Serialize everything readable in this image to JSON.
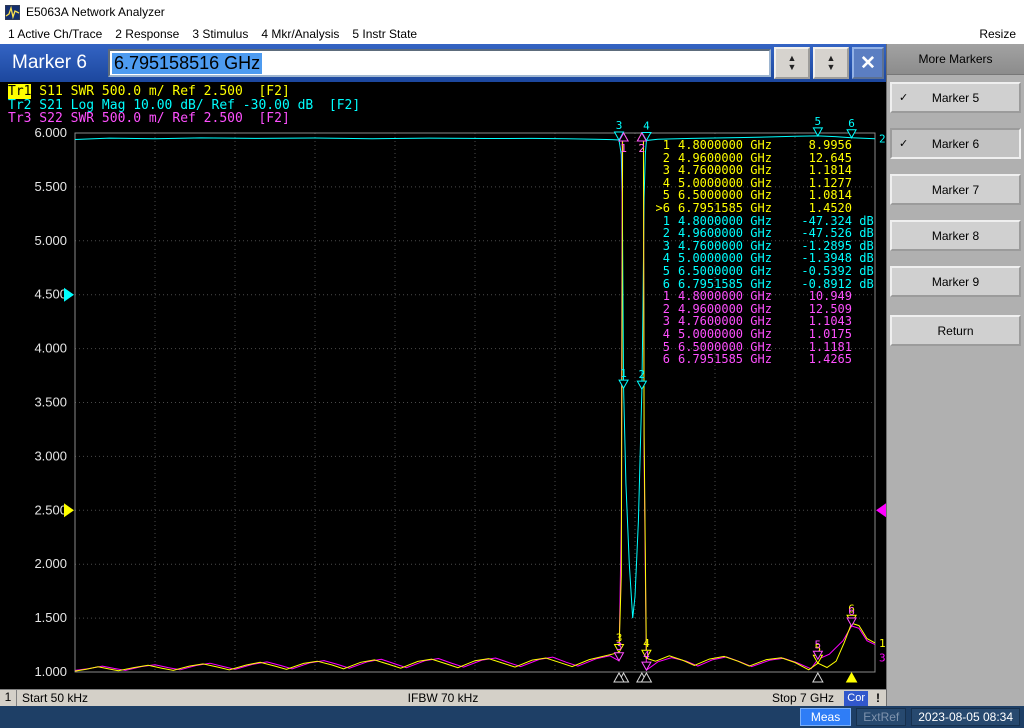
{
  "title_bar": {
    "title": "E5063A Network Analyzer"
  },
  "menu_bar": {
    "items": [
      "1 Active Ch/Trace",
      "2 Response",
      "3 Stimulus",
      "4 Mkr/Analysis",
      "5 Instr State"
    ],
    "resize": "Resize"
  },
  "marker_entry": {
    "label": "Marker 6",
    "value": "6.795158516 GHz"
  },
  "softkeys": {
    "header": "More Markers",
    "buttons": [
      {
        "label": "Marker 5",
        "checked": true,
        "active": false
      },
      {
        "label": "Marker 6",
        "checked": true,
        "active": true
      },
      {
        "label": "Marker 7",
        "checked": false,
        "active": false
      },
      {
        "label": "Marker 8",
        "checked": false,
        "active": false
      },
      {
        "label": "Marker 9",
        "checked": false,
        "active": false
      }
    ],
    "return_label": "Return"
  },
  "traces": [
    {
      "id": "Tr1",
      "label": "S11 SWR 500.0 m/ Ref 2.500",
      "status": "[F2]",
      "color": "#ffff00",
      "active": true
    },
    {
      "id": "Tr2",
      "label": "S21 Log Mag 10.00 dB/ Ref -30.00 dB",
      "status": "[F2]",
      "color": "#00ffff",
      "active": false
    },
    {
      "id": "Tr3",
      "label": "S22 SWR 500.0 m/ Ref 2.500",
      "status": "[F2]",
      "color": "#ff50ff",
      "active": false
    }
  ],
  "marker_table": {
    "tr1": {
      "color": "#ffff00",
      "unit": "",
      "rows": [
        {
          "n": "1",
          "f": "4.8000000 GHz",
          "v": "8.9956",
          "active": false
        },
        {
          "n": "2",
          "f": "4.9600000 GHz",
          "v": "12.645",
          "active": false
        },
        {
          "n": "3",
          "f": "4.7600000 GHz",
          "v": "1.1814",
          "active": false
        },
        {
          "n": "4",
          "f": "5.0000000 GHz",
          "v": "1.1277",
          "active": false
        },
        {
          "n": "5",
          "f": "6.5000000 GHz",
          "v": "1.0814",
          "active": false
        },
        {
          "n": "6",
          "f": "6.7951585 GHz",
          "v": "1.4520",
          "active": true
        }
      ]
    },
    "tr2": {
      "color": "#00ffff",
      "unit": " dB",
      "rows": [
        {
          "n": "1",
          "f": "4.8000000 GHz",
          "v": "-47.324",
          "active": false
        },
        {
          "n": "2",
          "f": "4.9600000 GHz",
          "v": "-47.526",
          "active": false
        },
        {
          "n": "3",
          "f": "4.7600000 GHz",
          "v": "-1.2895",
          "active": false
        },
        {
          "n": "4",
          "f": "5.0000000 GHz",
          "v": "-1.3948",
          "active": false
        },
        {
          "n": "5",
          "f": "6.5000000 GHz",
          "v": "-0.5392",
          "active": false
        },
        {
          "n": "6",
          "f": "6.7951585 GHz",
          "v": "-0.8912",
          "active": false
        }
      ]
    },
    "tr3": {
      "color": "#ff50ff",
      "unit": "",
      "rows": [
        {
          "n": "1",
          "f": "4.8000000 GHz",
          "v": "10.949",
          "active": false
        },
        {
          "n": "2",
          "f": "4.9600000 GHz",
          "v": "12.509",
          "active": false
        },
        {
          "n": "3",
          "f": "4.7600000 GHz",
          "v": "1.1043",
          "active": false
        },
        {
          "n": "4",
          "f": "5.0000000 GHz",
          "v": "1.0175",
          "active": false
        },
        {
          "n": "5",
          "f": "6.5000000 GHz",
          "v": "1.1181",
          "active": false
        },
        {
          "n": "6",
          "f": "6.7951585 GHz",
          "v": "1.4265",
          "active": false
        }
      ]
    }
  },
  "channel_status": {
    "channel": "1",
    "start": "Start 50 kHz",
    "ifbw": "IFBW 70 kHz",
    "stop": "Stop 7 GHz",
    "cor": "Cor",
    "warn": "!"
  },
  "status_bar": {
    "meas": "Meas",
    "extref": "ExtRef",
    "datetime": "2023-08-05 08:34"
  },
  "chart_data": {
    "type": "line",
    "title": "",
    "x_axis": {
      "label_start": "Start 50 kHz",
      "label_stop": "Stop 7 GHz",
      "min_ghz": 5e-05,
      "max_ghz": 7
    },
    "y_axis": {
      "ticks": [
        "6.000",
        "5.500",
        "5.000",
        "4.500",
        "4.000",
        "3.500",
        "3.000",
        "2.500",
        "2.000",
        "1.500",
        "1.000"
      ],
      "swr_min": 1.0,
      "swr_max": 6.0,
      "swr_per_div": 0.5,
      "tr2_ref_db": -30,
      "tr2_db_per_div": 10,
      "divisions": 10,
      "grid": true
    },
    "series": [
      {
        "name": "Tr1 S11 SWR",
        "color": "#ffff00",
        "unit": "SWR",
        "points": [
          [
            5e-05,
            1.008
          ],
          [
            0.1,
            1.025
          ],
          [
            0.2,
            1.048
          ],
          [
            0.3,
            1.028
          ],
          [
            0.38,
            1.012
          ],
          [
            0.52,
            1.042
          ],
          [
            0.64,
            1.062
          ],
          [
            0.76,
            1.035
          ],
          [
            0.86,
            1.015
          ],
          [
            1.0,
            1.055
          ],
          [
            1.12,
            1.075
          ],
          [
            1.25,
            1.045
          ],
          [
            1.35,
            1.02
          ],
          [
            1.5,
            1.065
          ],
          [
            1.62,
            1.09
          ],
          [
            1.75,
            1.055
          ],
          [
            1.85,
            1.025
          ],
          [
            2.0,
            1.08
          ],
          [
            2.12,
            1.1
          ],
          [
            2.25,
            1.065
          ],
          [
            2.35,
            1.03
          ],
          [
            2.5,
            1.09
          ],
          [
            2.62,
            1.112
          ],
          [
            2.75,
            1.07
          ],
          [
            2.85,
            1.035
          ],
          [
            3.0,
            1.098
          ],
          [
            3.12,
            1.12
          ],
          [
            3.25,
            1.075
          ],
          [
            3.35,
            1.04
          ],
          [
            3.5,
            1.105
          ],
          [
            3.62,
            1.124
          ],
          [
            3.75,
            1.08
          ],
          [
            3.85,
            1.045
          ],
          [
            4.0,
            1.11
          ],
          [
            4.12,
            1.13
          ],
          [
            4.25,
            1.085
          ],
          [
            4.35,
            1.05
          ],
          [
            4.5,
            1.115
          ],
          [
            4.62,
            1.145
          ],
          [
            4.7,
            1.165
          ],
          [
            4.76,
            1.1814
          ],
          [
            4.78,
            1.9
          ],
          [
            4.8,
            8.9956
          ],
          [
            4.84,
            25
          ],
          [
            4.88,
            34
          ],
          [
            4.93,
            26
          ],
          [
            4.96,
            12.645
          ],
          [
            4.98,
            3.2
          ],
          [
            5.0,
            1.1277
          ],
          [
            5.08,
            1.1
          ],
          [
            5.2,
            1.15
          ],
          [
            5.32,
            1.108
          ],
          [
            5.42,
            1.06
          ],
          [
            5.55,
            1.12
          ],
          [
            5.68,
            1.145
          ],
          [
            5.8,
            1.1
          ],
          [
            5.9,
            1.055
          ],
          [
            6.05,
            1.115
          ],
          [
            6.18,
            1.132
          ],
          [
            6.3,
            1.088
          ],
          [
            6.42,
            1.02
          ],
          [
            6.5,
            1.0814
          ],
          [
            6.58,
            1.042
          ],
          [
            6.66,
            1.1
          ],
          [
            6.73,
            1.27
          ],
          [
            6.7952,
            1.452
          ],
          [
            6.86,
            1.43
          ],
          [
            6.93,
            1.31
          ],
          [
            7.0,
            1.27
          ]
        ]
      },
      {
        "name": "Tr2 S21 Log Mag",
        "color": "#00ffff",
        "unit": "dB",
        "points": [
          [
            5e-05,
            -1.2
          ],
          [
            0.3,
            -0.95
          ],
          [
            0.7,
            -1.05
          ],
          [
            1.1,
            -0.9
          ],
          [
            1.6,
            -1.0
          ],
          [
            2.1,
            -0.92
          ],
          [
            2.6,
            -1.05
          ],
          [
            3.1,
            -0.95
          ],
          [
            3.6,
            -1.02
          ],
          [
            4.0,
            -1.0
          ],
          [
            4.3,
            -1.08
          ],
          [
            4.55,
            -1.15
          ],
          [
            4.7,
            -1.22
          ],
          [
            4.76,
            -1.2895
          ],
          [
            4.78,
            -4
          ],
          [
            4.79,
            -15
          ],
          [
            4.8,
            -47.324
          ],
          [
            4.82,
            -65
          ],
          [
            4.85,
            -80
          ],
          [
            4.88,
            -90
          ],
          [
            4.9,
            -86
          ],
          [
            4.93,
            -72
          ],
          [
            4.95,
            -56
          ],
          [
            4.96,
            -47.526
          ],
          [
            4.97,
            -32
          ],
          [
            4.98,
            -12
          ],
          [
            4.99,
            -4
          ],
          [
            5.0,
            -1.3948
          ],
          [
            5.1,
            -1.15
          ],
          [
            5.4,
            -1.0
          ],
          [
            5.8,
            -0.85
          ],
          [
            6.1,
            -0.72
          ],
          [
            6.3,
            -0.62
          ],
          [
            6.5,
            -0.5392
          ],
          [
            6.65,
            -0.66
          ],
          [
            6.7952,
            -0.8912
          ],
          [
            6.9,
            -0.98
          ],
          [
            7.0,
            -1.05
          ]
        ]
      },
      {
        "name": "Tr3 S22 SWR",
        "color": "#ff00ff",
        "unit": "SWR",
        "points": [
          [
            5e-05,
            1.015
          ],
          [
            0.12,
            1.032
          ],
          [
            0.24,
            1.055
          ],
          [
            0.34,
            1.033
          ],
          [
            0.44,
            1.015
          ],
          [
            0.58,
            1.05
          ],
          [
            0.7,
            1.068
          ],
          [
            0.82,
            1.04
          ],
          [
            0.92,
            1.02
          ],
          [
            1.06,
            1.06
          ],
          [
            1.18,
            1.082
          ],
          [
            1.3,
            1.05
          ],
          [
            1.4,
            1.025
          ],
          [
            1.56,
            1.072
          ],
          [
            1.68,
            1.094
          ],
          [
            1.8,
            1.06
          ],
          [
            1.9,
            1.03
          ],
          [
            2.06,
            1.086
          ],
          [
            2.18,
            1.106
          ],
          [
            2.3,
            1.07
          ],
          [
            2.4,
            1.035
          ],
          [
            2.56,
            1.096
          ],
          [
            2.68,
            1.118
          ],
          [
            2.8,
            1.075
          ],
          [
            2.9,
            1.04
          ],
          [
            3.06,
            1.104
          ],
          [
            3.18,
            1.125
          ],
          [
            3.3,
            1.08
          ],
          [
            3.4,
            1.045
          ],
          [
            3.56,
            1.11
          ],
          [
            3.68,
            1.13
          ],
          [
            3.8,
            1.085
          ],
          [
            3.9,
            1.05
          ],
          [
            4.06,
            1.116
          ],
          [
            4.18,
            1.138
          ],
          [
            4.3,
            1.09
          ],
          [
            4.4,
            1.055
          ],
          [
            4.56,
            1.122
          ],
          [
            4.68,
            1.15
          ],
          [
            4.76,
            1.1043
          ],
          [
            4.78,
            2.4
          ],
          [
            4.8,
            10.949
          ],
          [
            4.84,
            26
          ],
          [
            4.88,
            35
          ],
          [
            4.93,
            27
          ],
          [
            4.96,
            12.509
          ],
          [
            4.98,
            3.0
          ],
          [
            5.0,
            1.0175
          ],
          [
            5.1,
            1.095
          ],
          [
            5.22,
            1.134
          ],
          [
            5.35,
            1.1
          ],
          [
            5.45,
            1.055
          ],
          [
            5.58,
            1.114
          ],
          [
            5.7,
            1.14
          ],
          [
            5.82,
            1.095
          ],
          [
            5.92,
            1.05
          ],
          [
            6.08,
            1.11
          ],
          [
            6.2,
            1.128
          ],
          [
            6.32,
            1.085
          ],
          [
            6.44,
            1.03
          ],
          [
            6.5,
            1.1181
          ],
          [
            6.6,
            1.165
          ],
          [
            6.72,
            1.29
          ],
          [
            6.7952,
            1.4265
          ],
          [
            6.86,
            1.405
          ],
          [
            6.93,
            1.29
          ],
          [
            7.0,
            1.255
          ]
        ]
      }
    ],
    "ref_markers": [
      {
        "trace": 1,
        "side": "left",
        "value_swr": 2.5,
        "color": "#ffff00"
      },
      {
        "trace": 2,
        "side": "left",
        "value_db": -30,
        "color": "#00ffff"
      },
      {
        "trace": 3,
        "side": "right",
        "value_swr": 2.5,
        "color": "#ff00ff"
      }
    ]
  }
}
